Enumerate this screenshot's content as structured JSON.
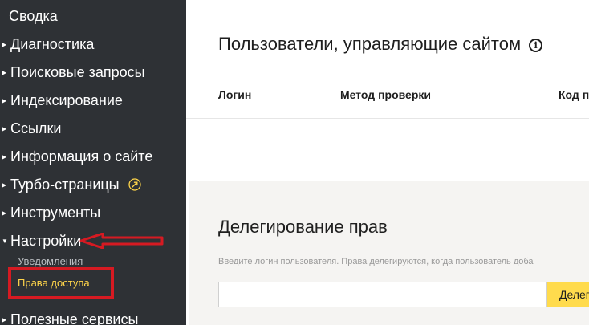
{
  "sidebar": {
    "summary_label": "Сводка",
    "items": [
      {
        "label": "Диагностика"
      },
      {
        "label": "Поисковые запросы"
      },
      {
        "label": "Индексирование"
      },
      {
        "label": "Ссылки"
      },
      {
        "label": "Информация о сайте"
      },
      {
        "label": "Турбо-страницы",
        "icon": "rocket-icon"
      },
      {
        "label": "Инструменты"
      },
      {
        "label": "Настройки",
        "expanded": true
      }
    ],
    "settings_subitems": [
      {
        "label": "Уведомления"
      },
      {
        "label": "Права доступа",
        "active": true
      }
    ],
    "after_items": [
      {
        "label": "Полезные сервисы"
      }
    ],
    "collapsed_caret": "▶",
    "expanded_caret": "▼"
  },
  "main": {
    "users_section": {
      "title": "Пользователи, управляющие сайтом",
      "info_icon_glyph": "i",
      "columns": [
        "Логин",
        "Метод проверки",
        "Код п"
      ]
    },
    "delegation_section": {
      "title": "Делегирование прав",
      "hint": "Введите логин пользователя. Права делегируются, когда пользователь доба",
      "input_value": "",
      "input_placeholder": "",
      "button_label": "Делегировать"
    }
  },
  "annotation": {
    "color": "#d61a22"
  },
  "colors": {
    "sidebar_bg": "#2e3135",
    "active_item": "#ffd54a",
    "button_bg": "#ffdb4d",
    "delegation_bg": "#f5f4f2"
  }
}
